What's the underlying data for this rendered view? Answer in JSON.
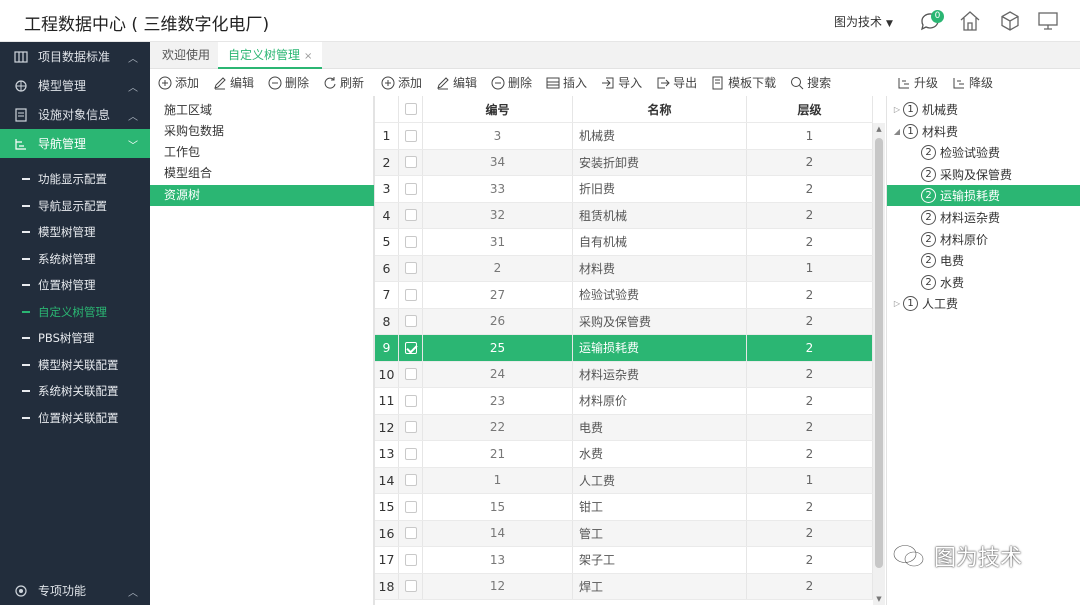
{
  "app": {
    "title": "工程数据中心 ( 三维数字化电厂)"
  },
  "header": {
    "user": "图为技术",
    "notification_count": "0"
  },
  "sidebar": {
    "items": [
      {
        "label": "项目数据标准"
      },
      {
        "label": "模型管理"
      },
      {
        "label": "设施对象信息"
      },
      {
        "label": "导航管理"
      }
    ],
    "subitems": [
      {
        "label": "功能显示配置"
      },
      {
        "label": "导航显示配置"
      },
      {
        "label": "模型树管理"
      },
      {
        "label": "系统树管理"
      },
      {
        "label": "位置树管理"
      },
      {
        "label": "自定义树管理"
      },
      {
        "label": "PBS树管理"
      },
      {
        "label": "模型树关联配置"
      },
      {
        "label": "系统树关联配置"
      },
      {
        "label": "位置树关联配置"
      }
    ],
    "bottom": {
      "label": "专项功能"
    }
  },
  "tabs": [
    {
      "label": "欢迎使用"
    },
    {
      "label": "自定义树管理"
    }
  ],
  "left_toolbar": {
    "add": "添加",
    "edit": "编辑",
    "delete": "删除",
    "refresh": "刷新"
  },
  "left_list": [
    "施工区域",
    "采购包数据",
    "工作包",
    "模型组合",
    "资源树"
  ],
  "table_toolbar": {
    "add": "添加",
    "edit": "编辑",
    "delete": "删除",
    "insert": "插入",
    "import": "导入",
    "export": "导出",
    "template": "模板下载",
    "search": "搜索"
  },
  "table": {
    "headers": {
      "code": "编号",
      "name": "名称",
      "level": "层级"
    },
    "rows": [
      {
        "idx": "1",
        "code": "3",
        "name": "机械费",
        "level": "1"
      },
      {
        "idx": "2",
        "code": "34",
        "name": "安装折卸费",
        "level": "2"
      },
      {
        "idx": "3",
        "code": "33",
        "name": "折旧费",
        "level": "2"
      },
      {
        "idx": "4",
        "code": "32",
        "name": "租赁机械",
        "level": "2"
      },
      {
        "idx": "5",
        "code": "31",
        "name": "自有机械",
        "level": "2"
      },
      {
        "idx": "6",
        "code": "2",
        "name": "材料费",
        "level": "1"
      },
      {
        "idx": "7",
        "code": "27",
        "name": "检验试验费",
        "level": "2"
      },
      {
        "idx": "8",
        "code": "26",
        "name": "采购及保管费",
        "level": "2"
      },
      {
        "idx": "9",
        "code": "25",
        "name": "运输损耗费",
        "level": "2"
      },
      {
        "idx": "10",
        "code": "24",
        "name": "材料运杂费",
        "level": "2"
      },
      {
        "idx": "11",
        "code": "23",
        "name": "材料原价",
        "level": "2"
      },
      {
        "idx": "12",
        "code": "22",
        "name": "电费",
        "level": "2"
      },
      {
        "idx": "13",
        "code": "21",
        "name": "水费",
        "level": "2"
      },
      {
        "idx": "14",
        "code": "1",
        "name": "人工费",
        "level": "1"
      },
      {
        "idx": "15",
        "code": "15",
        "name": "钳工",
        "level": "2"
      },
      {
        "idx": "16",
        "code": "14",
        "name": "管工",
        "level": "2"
      },
      {
        "idx": "17",
        "code": "13",
        "name": "架子工",
        "level": "2"
      },
      {
        "idx": "18",
        "code": "12",
        "name": "焊工",
        "level": "2"
      }
    ]
  },
  "tree_toolbar": {
    "upgrade": "升级",
    "downgrade": "降级"
  },
  "tree": [
    {
      "level": "1",
      "label": "机械费",
      "indent": 0,
      "caret": "collapsed"
    },
    {
      "level": "1",
      "label": "材料费",
      "indent": 0,
      "caret": "expanded"
    },
    {
      "level": "2",
      "label": "检验试验费",
      "indent": 1
    },
    {
      "level": "2",
      "label": "采购及保管费",
      "indent": 1
    },
    {
      "level": "2",
      "label": "运输损耗费",
      "indent": 1
    },
    {
      "level": "2",
      "label": "材料运杂费",
      "indent": 1
    },
    {
      "level": "2",
      "label": "材料原价",
      "indent": 1
    },
    {
      "level": "2",
      "label": "电费",
      "indent": 1
    },
    {
      "level": "2",
      "label": "水费",
      "indent": 1
    },
    {
      "level": "1",
      "label": "人工费",
      "indent": 0,
      "caret": "collapsed"
    }
  ],
  "watermark": {
    "text": "图为技术"
  },
  "colors": {
    "accent": "#2bb673",
    "sidebar": "#222d3c"
  }
}
